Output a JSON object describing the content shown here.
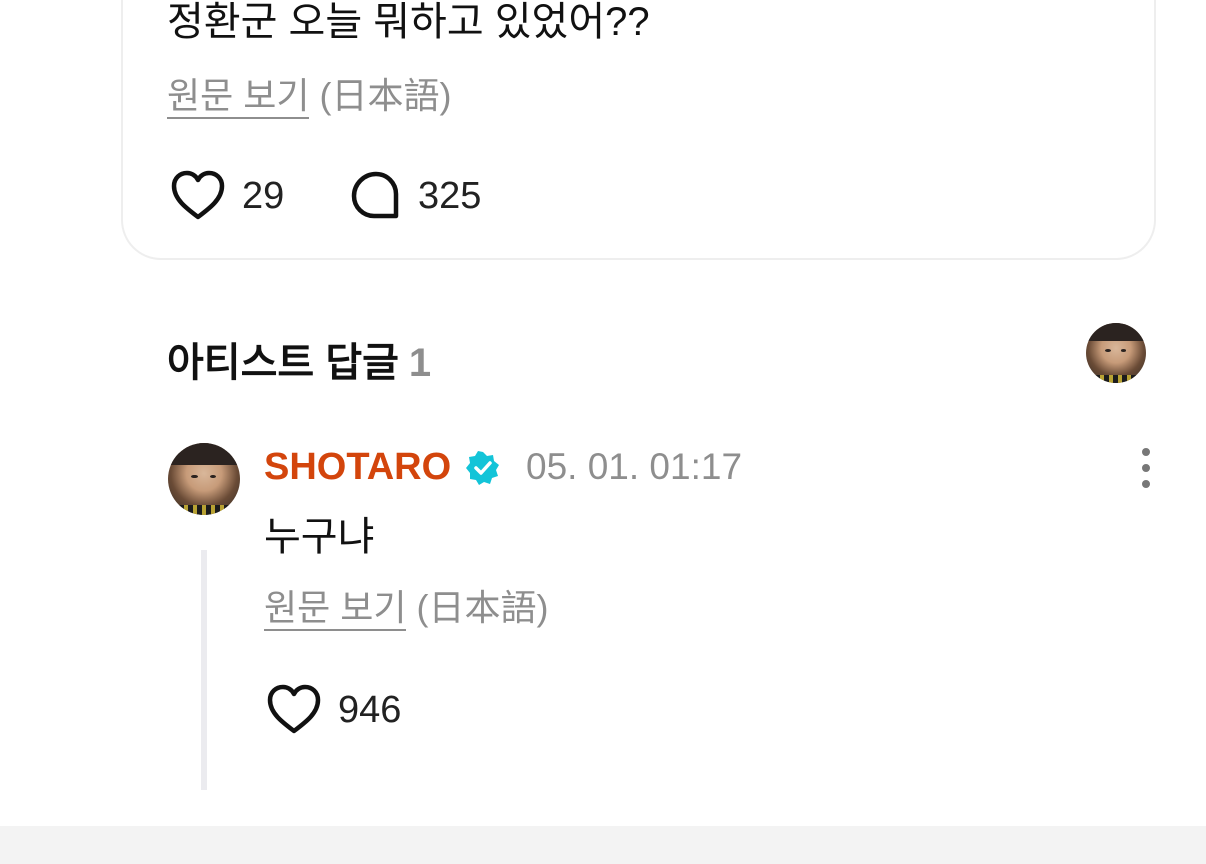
{
  "post": {
    "text": "정환군 오늘 뭐하고 있었어??",
    "translate_link": "원문 보기",
    "translate_lang": "(日本語)",
    "likes": "29",
    "comments": "325"
  },
  "artist_replies": {
    "title": "아티스트 답글",
    "count": "1"
  },
  "reply": {
    "author": "SHOTARO",
    "time": "05. 01. 01:17",
    "text": "누구냐",
    "translate_link": "원문 보기",
    "translate_lang": "(日本語)",
    "likes": "946"
  },
  "colors": {
    "author_accent": "#d3450c",
    "verified_badge": "#13c4d8",
    "muted_text": "#8e8e8e"
  },
  "icons": [
    "heart-icon",
    "comment-bubble-icon",
    "verified-badge-icon",
    "more-vertical-icon"
  ]
}
